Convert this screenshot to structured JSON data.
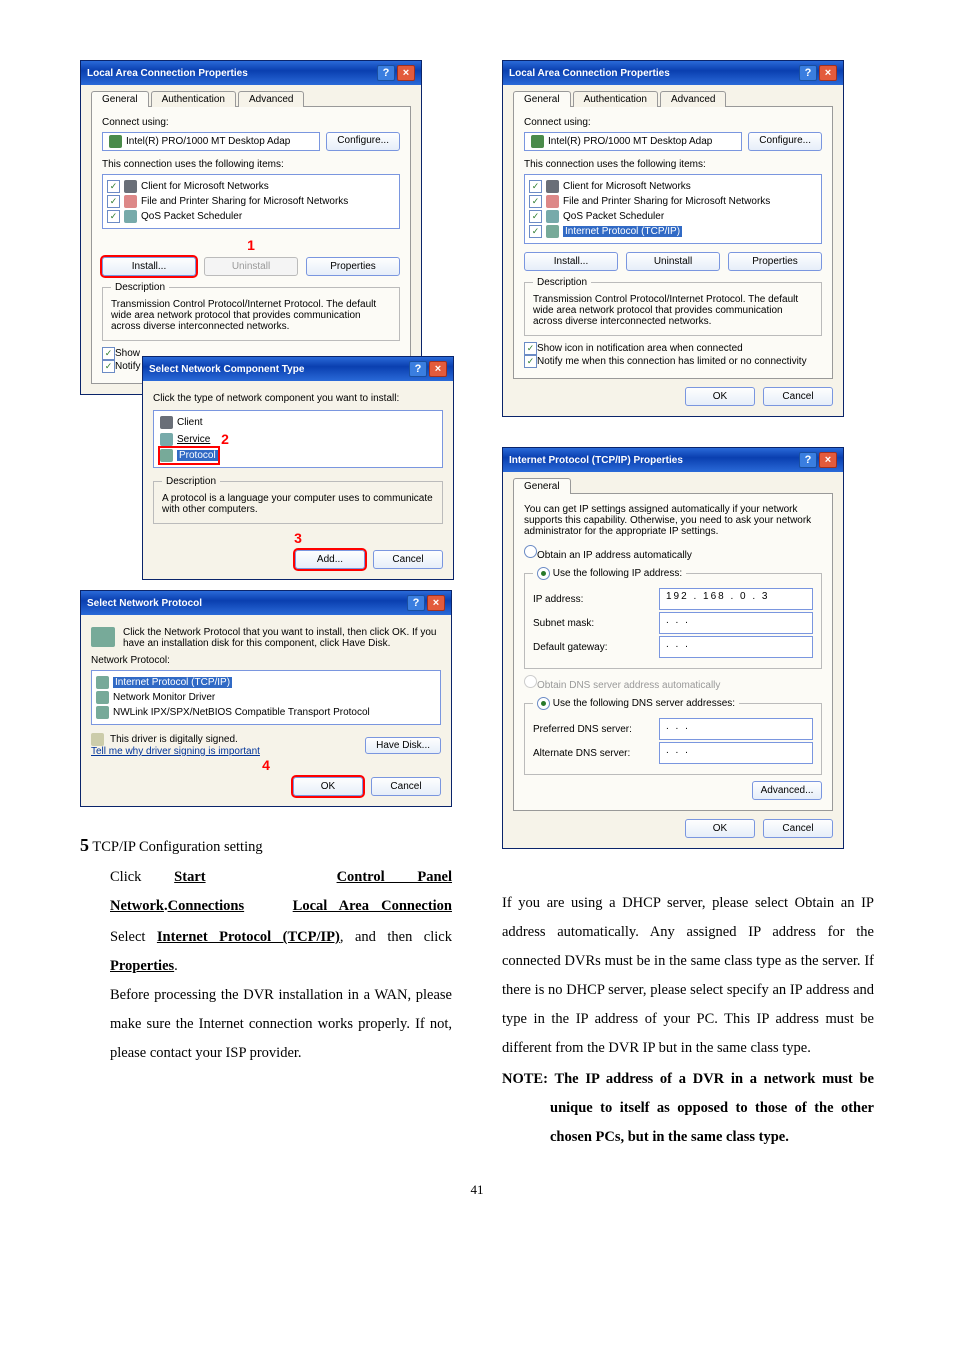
{
  "dlg1": {
    "title": "Local Area Connection Properties",
    "tabs": [
      "General",
      "Authentication",
      "Advanced"
    ],
    "connect_using": "Connect using:",
    "adapter": "Intel(R) PRO/1000 MT Desktop Adap",
    "configure": "Configure...",
    "uses_items": "This connection uses the following items:",
    "items": [
      "Client for Microsoft Networks",
      "File and Printer Sharing for Microsoft Networks",
      "QoS Packet Scheduler"
    ],
    "install": "Install...",
    "uninstall": "Uninstall",
    "properties": "Properties",
    "desc_legend": "Description",
    "desc_text": "Transmission Control Protocol/Internet Protocol. The default wide area network protocol that provides communication across diverse interconnected networks.",
    "show_icon": "Show",
    "notify": "Notify"
  },
  "dlg_sn": {
    "title": "Select Network Component Type",
    "click_type": "Click the type of network component you want to install:",
    "client": "Client",
    "service": "Service",
    "protocol": "Protocol",
    "desc_legend": "Description",
    "desc_text": "A protocol is a language your computer uses to communicate with other computers.",
    "add": "Add...",
    "cancel": "Cancel"
  },
  "dlg_snp": {
    "title": "Select Network Protocol",
    "instr": "Click the Network Protocol that you want to install, then click OK. If you have an installation disk for this component, click Have Disk.",
    "np_label": "Network Protocol:",
    "items": [
      "Internet Protocol (TCP/IP)",
      "Network Monitor Driver",
      "NWLink IPX/SPX/NetBIOS Compatible Transport Protocol"
    ],
    "signed": "This driver is digitally signed.",
    "tellme": "Tell me why driver signing is important",
    "have_disk": "Have Disk...",
    "ok": "OK",
    "cancel": "Cancel"
  },
  "dlg2": {
    "title": "Local Area Connection Properties",
    "tabs": [
      "General",
      "Authentication",
      "Advanced"
    ],
    "connect_using": "Connect using:",
    "adapter": "Intel(R) PRO/1000 MT Desktop Adap",
    "configure": "Configure...",
    "uses_items": "This connection uses the following items:",
    "items": [
      "Client for Microsoft Networks",
      "File and Printer Sharing for Microsoft Networks",
      "QoS Packet Scheduler",
      "Internet Protocol (TCP/IP)"
    ],
    "install": "Install...",
    "uninstall": "Uninstall",
    "properties": "Properties",
    "desc_legend": "Description",
    "desc_text": "Transmission Control Protocol/Internet Protocol. The default wide area network protocol that provides communication across diverse interconnected networks.",
    "show_icon": "Show icon in notification area when connected",
    "notify": "Notify me when this connection has limited or no connectivity",
    "ok": "OK",
    "cancel": "Cancel"
  },
  "dlg_ip": {
    "title": "Internet Protocol (TCP/IP) Properties",
    "tab": "General",
    "intro": "You can get IP settings assigned automatically if your network supports this capability. Otherwise, you need to ask your network administrator for the appropriate IP settings.",
    "obtain_auto": "Obtain an IP address automatically",
    "use_following": "Use the following IP address:",
    "ip_label": "IP address:",
    "ip_value": "192 . 168 .  0  .   3",
    "subnet_label": "Subnet mask:",
    "subnet_value": " .      .      . ",
    "gateway_label": "Default gateway:",
    "gateway_value": " .      .      . ",
    "obtain_dns_auto": "Obtain DNS server address automatically",
    "use_dns": "Use the following DNS server addresses:",
    "pref_dns": "Preferred DNS server:",
    "alt_dns": "Alternate DNS server:",
    "dns_blank": " .      .      . ",
    "advanced": "Advanced...",
    "ok": "OK",
    "cancel": "Cancel"
  },
  "marks": {
    "m1": "1",
    "m2": "2",
    "m3": "3",
    "m4": "4"
  },
  "section": {
    "num": "5",
    "title": " TCP/IP Configuration setting",
    "l1a": "Click ",
    "l1b": "Start",
    "l1c": "Control Panel",
    "l1d": "Network",
    "l1e": "Connections",
    "l1f": "Local Area Connection",
    "l2a": "Select ",
    "l2b": "Internet Protocol (TCP/IP)",
    "l2c": ", and then click ",
    "l2d": "Properties",
    "l2e": ".",
    "p1": "Before processing the DVR installation in a WAN, please make sure the Internet connection works properly. If not, please contact your ISP provider."
  },
  "rightbody": {
    "p1": "If you are using a DHCP server, please select Obtain an IP address automatically. Any assigned IP address for the connected DVRs must be in the same class type as the server. If there is no DHCP server, please select specify an IP address and type in the IP address of your PC. This IP address must be different from the DVR IP but in the same class type.",
    "note_head": "NOTE: ",
    "note_body": "The IP address of a DVR in a network must be unique to itself as opposed to those of the other chosen PCs, but in the same class type."
  },
  "page_num": "41"
}
